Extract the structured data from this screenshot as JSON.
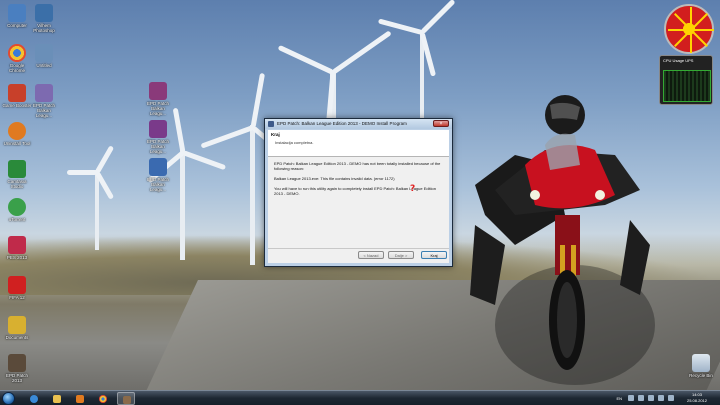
{
  "desktop_icons": [
    {
      "label": "Computer",
      "color": "#4a7fc0"
    },
    {
      "label": "Vilhem Photoshop",
      "color": "#3b6fa8"
    },
    {
      "label": "Google Chrome",
      "color": "#e34a2f"
    },
    {
      "label": "Untitled",
      "color": "#6a8fb8"
    },
    {
      "label": "Game Booster",
      "color": "#c8402a"
    },
    {
      "label": "EPD Patch Balkan Leagu...",
      "color": "#7d6ab0"
    },
    {
      "label": "EPD Patch Balkan Leagu...",
      "color": "#8a3a7a"
    },
    {
      "label": "Uninstall Tool",
      "color": "#e07a20"
    },
    {
      "label": "EPD Patch Balkan Leagu...",
      "color": "#7a3a8a"
    },
    {
      "label": "EPD Patch Balkan Leagu...",
      "color": "#3a6ab0"
    },
    {
      "label": "Camtasia Studio",
      "color": "#2a8a3a"
    },
    {
      "label": "uTorrent",
      "color": "#3aa04a"
    },
    {
      "label": "PES 2013",
      "color": "#c02a4a"
    },
    {
      "label": "FIFA 12",
      "color": "#d02020"
    },
    {
      "label": "Documents",
      "color": "#d8b030"
    },
    {
      "label": "EPD Patch 2013",
      "color": "#5a4a3a"
    }
  ],
  "recycle_bin": {
    "label": "Recycle Bin"
  },
  "gadgets": {
    "cpu_title": "CPU Usage  UPS",
    "clock_colors": {
      "face": "#d21e1e",
      "sun": "#ffd400"
    }
  },
  "dialog": {
    "title": "EPD Patch: Balkan League Edition 2013 - DEMO Install Program",
    "close_label": "×",
    "header_title": "Kraj",
    "header_subtitle": "Instalacija completna.",
    "message_1": "EPD Patch: Balkan League Edition 2013 - DEMO has not been totally installed because of the following reason:",
    "message_2": "Balkan League 2013.exe: This file contains invalid data. (error 1172)",
    "message_3": "You will have to run this utility again to completely install EPD Patch: Balkan League Edition 2013 - DEMO.",
    "qmark": "?",
    "buttons": {
      "back": "< Nazad",
      "next": "Dalje >",
      "finish": "Kraj"
    }
  },
  "taskbar": {
    "items": [
      {
        "name": "internet-explorer",
        "color": "#3a8ad8"
      },
      {
        "name": "windows-explorer",
        "color": "#e8c050"
      },
      {
        "name": "media-player",
        "color": "#e07a20"
      },
      {
        "name": "google-chrome",
        "color": "#e34a2f"
      },
      {
        "name": "installer",
        "color": "#8a6a4a"
      }
    ],
    "language": "EN",
    "time": "14:03",
    "date": "25.08.2012"
  }
}
